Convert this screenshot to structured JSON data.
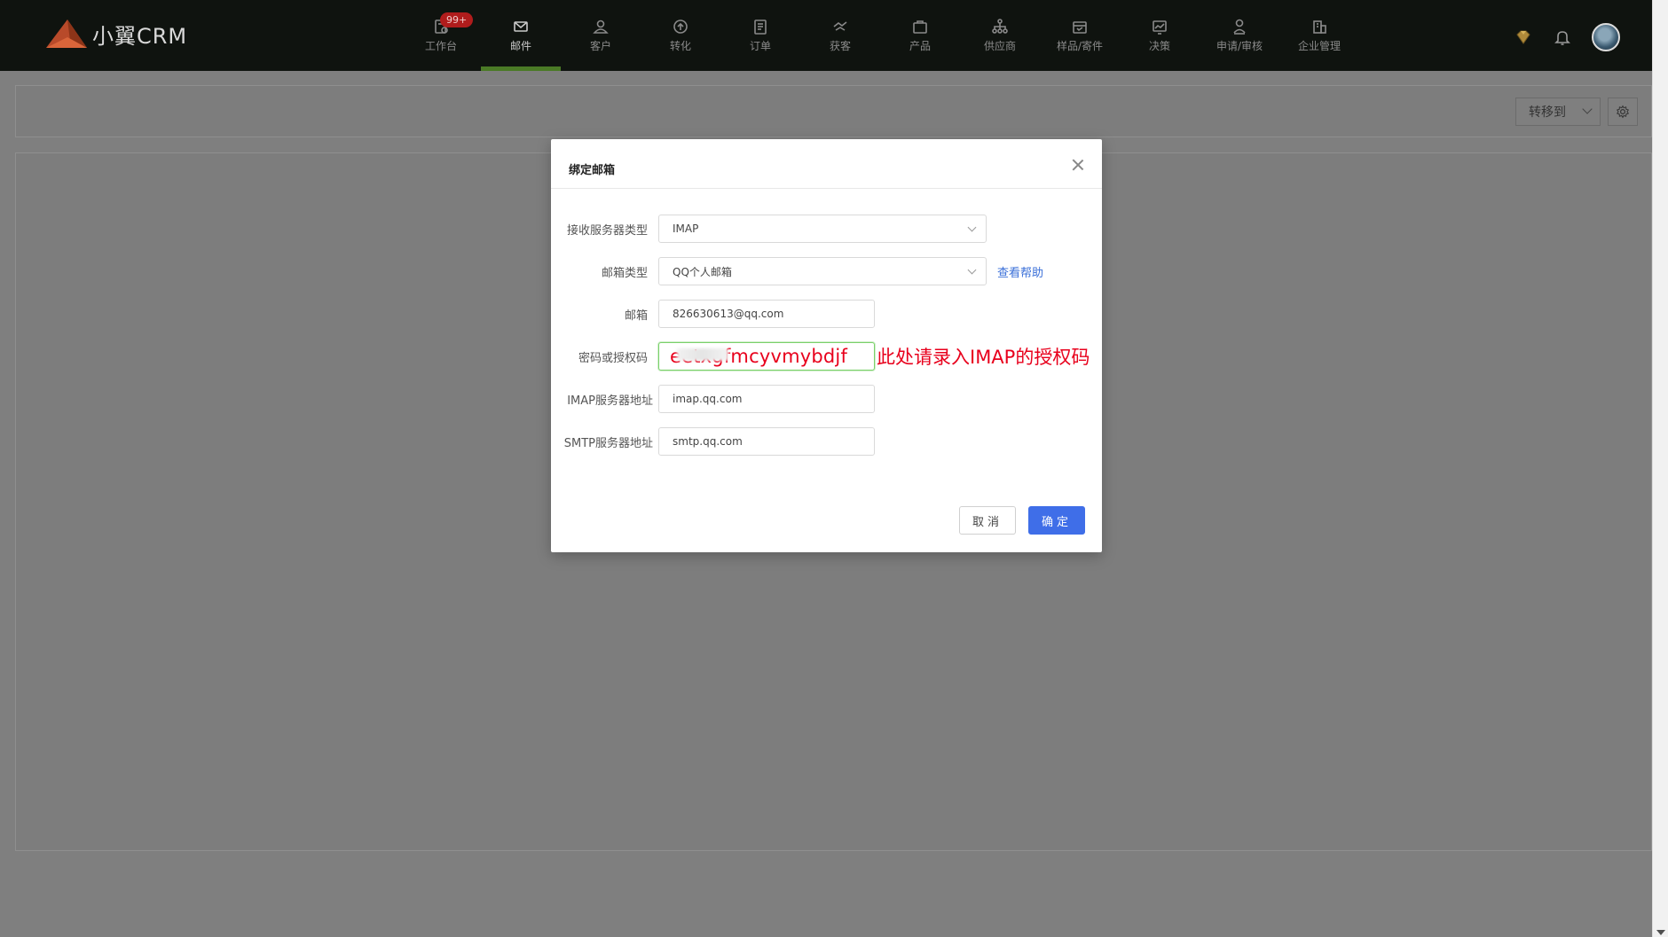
{
  "app": {
    "title": "小翼CRM"
  },
  "nav": {
    "items": [
      {
        "label": "工作台",
        "icon": "workbench-icon",
        "badge": "99+"
      },
      {
        "label": "邮件",
        "icon": "mail-icon",
        "active": true
      },
      {
        "label": "客户",
        "icon": "customer-icon"
      },
      {
        "label": "转化",
        "icon": "conversion-icon"
      },
      {
        "label": "订单",
        "icon": "order-icon"
      },
      {
        "label": "获客",
        "icon": "acquisition-icon"
      },
      {
        "label": "产品",
        "icon": "product-icon"
      },
      {
        "label": "供应商",
        "icon": "supplier-icon"
      },
      {
        "label": "样品/寄件",
        "icon": "sample-icon"
      },
      {
        "label": "决策",
        "icon": "decision-icon"
      },
      {
        "label": "申请/审核",
        "icon": "approval-icon"
      },
      {
        "label": "企业管理",
        "icon": "enterprise-icon"
      }
    ]
  },
  "toolbar": {
    "transfer_label": "转移到"
  },
  "modal": {
    "title": "绑定邮箱",
    "fields": {
      "server_type": {
        "label": "接收服务器类型",
        "value": "IMAP"
      },
      "mailbox_type": {
        "label": "邮箱类型",
        "value": "QQ个人邮箱",
        "help": "查看帮助"
      },
      "email": {
        "label": "邮箱",
        "value": "826630613@qq.com"
      },
      "password": {
        "label": "密码或授权码",
        "value": "eetxgfmcyvmybdjf",
        "annotation": "此处请录入IMAP的授权码"
      },
      "imap": {
        "label": "IMAP服务器地址",
        "value": "imap.qq.com"
      },
      "smtp": {
        "label": "SMTP服务器地址",
        "value": "smtp.qq.com"
      }
    },
    "cancel_label": "取消",
    "ok_label": "确定"
  },
  "colors": {
    "primary": "#3f6ee8",
    "nav_active": "#4a7a26",
    "badge": "#b01c1c",
    "annotation": "#e8001c",
    "focus": "#7ad06a"
  }
}
